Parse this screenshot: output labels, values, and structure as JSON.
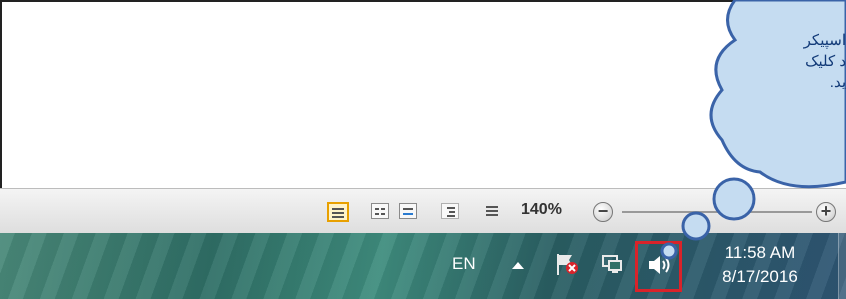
{
  "statusbar": {
    "views": [
      "print-layout",
      "full-screen-reading",
      "web-layout",
      "outline",
      "draft"
    ],
    "zoom": "140%",
    "zoom_out": "−",
    "zoom_in": "+"
  },
  "taskbar": {
    "language": "EN",
    "clock_time": "11:58 AM",
    "clock_date": "8/17/2016"
  },
  "callout": {
    "lines": [
      "اسپیکر",
      "د کلیک",
      "ید."
    ],
    "fill": "#c5dcf1",
    "stroke": "#3a63a8"
  },
  "colors": {
    "highlight": "#d9232a",
    "view_active": "#e8a000"
  }
}
